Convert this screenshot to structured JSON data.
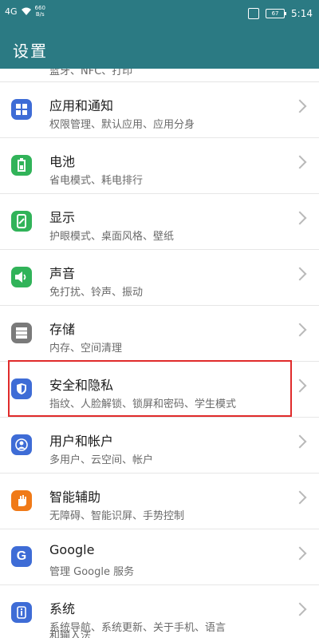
{
  "status": {
    "network": "4G",
    "speed_value": "660",
    "speed_unit": "B/s",
    "battery": "67",
    "time": "5:14"
  },
  "app": {
    "title": "设置"
  },
  "top_partial": {
    "sub": "蓝牙、NFC、打印"
  },
  "rows": [
    {
      "title": "应用和通知",
      "sub": "权限管理、默认应用、应用分身",
      "icon": "apps-grid-icon",
      "color": "#3e6cd6"
    },
    {
      "title": "电池",
      "sub": "省电模式、耗电排行",
      "icon": "battery-icon",
      "color": "#31b359"
    },
    {
      "title": "显示",
      "sub": "护眼模式、桌面风格、壁纸",
      "icon": "display-icon",
      "color": "#31b359"
    },
    {
      "title": "声音",
      "sub": "免打扰、铃声、振动",
      "icon": "speaker-icon",
      "color": "#31b359"
    },
    {
      "title": "存储",
      "sub": "内存、空间清理",
      "icon": "storage-icon",
      "color": "#7a7a7a"
    },
    {
      "title": "安全和隐私",
      "sub": "指纹、人脸解锁、锁屏和密码、学生模式",
      "icon": "shield-icon",
      "color": "#3e6cd6"
    },
    {
      "title": "用户和帐户",
      "sub": "多用户、云空间、帐户",
      "icon": "user-icon",
      "color": "#3e6cd6"
    },
    {
      "title": "智能辅助",
      "sub": "无障碍、智能识屏、手势控制",
      "icon": "hand-icon",
      "color": "#f07a18"
    },
    {
      "title": "Google",
      "sub": "管理 Google 服务",
      "icon": "google-icon",
      "color": "#3e6cd6"
    },
    {
      "title": "系统",
      "sub": "系统导航、系统更新、关于手机、语言",
      "icon": "system-info-icon",
      "color": "#3e6cd6"
    }
  ],
  "bottom_partial": {
    "sub": "和输入法"
  }
}
